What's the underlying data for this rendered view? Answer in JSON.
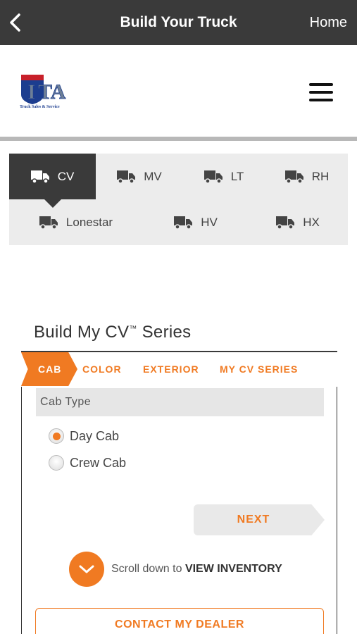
{
  "topbar": {
    "title": "Build Your Truck",
    "home_label": "Home",
    "back_icon": "chevron-left-icon"
  },
  "header": {
    "logo_text": "ITA",
    "logo_subtitle": "Truck Sales & Service",
    "menu_icon": "hamburger-menu-icon"
  },
  "series_tabs": [
    {
      "label": "CV",
      "active": true
    },
    {
      "label": "MV",
      "active": false
    },
    {
      "label": "LT",
      "active": false
    },
    {
      "label": "RH",
      "active": false
    },
    {
      "label": "Lonestar",
      "active": false
    },
    {
      "label": "HV",
      "active": false
    },
    {
      "label": "HX",
      "active": false
    }
  ],
  "build": {
    "title": "Build My CV",
    "trademark": "™",
    "title_suffix": " Series",
    "steps": [
      "CAB",
      "COLOR",
      "EXTERIOR",
      "MY CV SERIES"
    ],
    "active_step": "CAB",
    "section_label": "Cab Type",
    "options": [
      {
        "label": "Day Cab",
        "selected": true
      },
      {
        "label": "Crew Cab",
        "selected": false
      }
    ],
    "next_label": "NEXT",
    "scroll_prefix": "Scroll down to ",
    "scroll_action": "VIEW INVENTORY",
    "contact_label": "CONTACT MY DEALER"
  },
  "colors": {
    "accent": "#f07a22",
    "dark": "#3a3a3a",
    "panel": "#ececec"
  }
}
